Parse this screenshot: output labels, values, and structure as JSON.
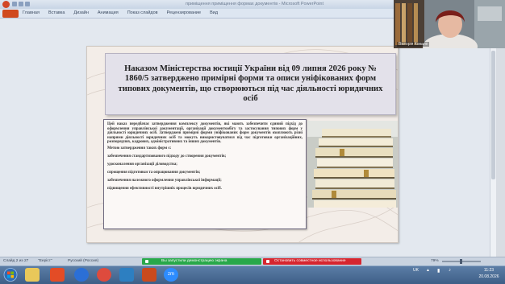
{
  "window": {
    "title": "приміщення приміщення формах документів - Microsoft PowerPoint"
  },
  "ribbon": {
    "tabs": [
      "Главная",
      "Вставка",
      "Дизайн",
      "Анимация",
      "Показ слайдов",
      "Рецензирование",
      "Вид"
    ]
  },
  "slide": {
    "title": "Наказом Міністерства юстиції України від 09 липня 2026 року № 1860/5 затверджено примірні форми та описи уніфікованих форм типових документів, що створюються під час діяльності юридичних осіб",
    "intro": "Цей наказ передбачає затвердження комплексу документів, які мають забезпечити єдиний підхід до оформлення управлінської документації, організації документообігу та застосування типових форм у діяльності юридичних осіб. Затверджені примірні форми уніфікованих форм документів охоплюють різні напрями діяльності юридичних осіб та можуть використовуватися під час підготовки організаційних, розпорядчих, кадрових, адміністративних та інших документів.",
    "methods_heading": "Метою затвердження таких форм є:",
    "items": [
      "забезпечення стандартизованого підходу до створення документів;",
      "удосконалення організації діловодства;",
      "спрощення підготовки та опрацювання документів;",
      "забезпечення належного оформлення управлінської інформації;",
      "підвищення ефективності внутрішніх процесів юридичних осіб."
    ]
  },
  "video": {
    "participant_name": "Вікторія Ковале"
  },
  "status": {
    "slide_counter": "Слайд 2 из 27",
    "theme": "\"Ееріст\"",
    "language": "Русский (Россия)",
    "demo_notice": "Вы запустили демонстрацию экрана",
    "stop_sharing": "Остановить совместное использование",
    "zoom": "79%"
  },
  "taskbar": {
    "zoom_app_label": "zm",
    "lang": "UK",
    "time": "11:23",
    "date": "20.08.2026"
  },
  "colors": {
    "green_notice": "#28a84a",
    "red_button": "#d6262f",
    "powerpoint_orange": "#d04a1f"
  }
}
